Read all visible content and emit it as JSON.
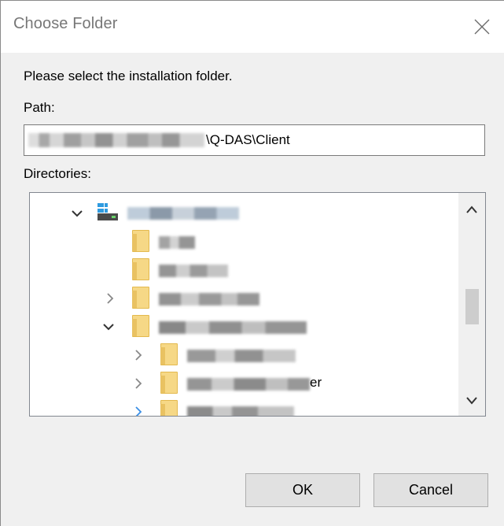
{
  "dialog": {
    "title": "Choose Folder",
    "close_icon": "close-icon",
    "prompt": "Please select the installation folder.",
    "path_label": "Path:",
    "path_value_visible": "\\Q-DAS\\Client",
    "directories_label": "Directories:"
  },
  "tree": {
    "items": [
      {
        "kind": "drive",
        "expanded": true,
        "icon": "drive-icon",
        "label_redacted": true
      },
      {
        "kind": "folder",
        "expanded": null,
        "icon": "folder-icon",
        "label_redacted": true
      },
      {
        "kind": "folder",
        "expanded": null,
        "icon": "folder-icon",
        "label_redacted": true
      },
      {
        "kind": "folder",
        "expanded": false,
        "icon": "folder-icon",
        "label_redacted": true
      },
      {
        "kind": "folder",
        "expanded": true,
        "icon": "folder-icon",
        "label_redacted": true
      },
      {
        "kind": "folder",
        "expanded": false,
        "icon": "folder-icon",
        "label_redacted": true
      },
      {
        "kind": "folder",
        "expanded": false,
        "icon": "folder-icon",
        "label_redacted": true,
        "visible_tail": "er"
      },
      {
        "kind": "folder",
        "expanded": false,
        "icon": "folder-icon",
        "label_redacted": true,
        "highlighted": true
      }
    ]
  },
  "scrollbar": {
    "up_icon": "chevron-up-icon",
    "down_icon": "chevron-down-icon"
  },
  "buttons": {
    "ok": "OK",
    "cancel": "Cancel"
  },
  "colors": {
    "dialog_bg": "#f0f0f0",
    "folder_fill": "#f6d886",
    "chevron_highlight": "#3a8ee6",
    "button_bg": "#e1e1e1"
  }
}
